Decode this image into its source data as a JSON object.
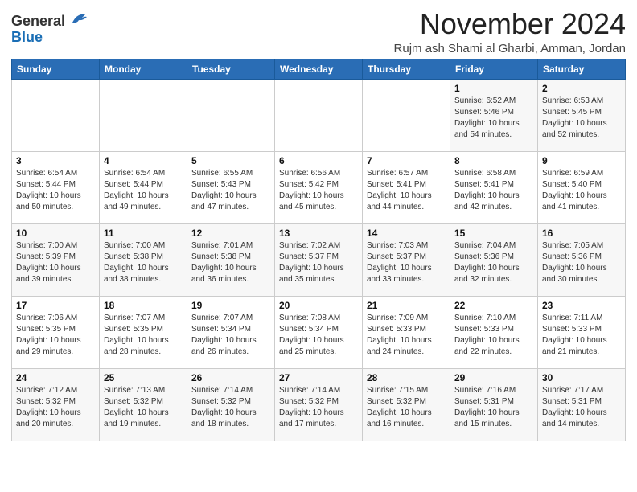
{
  "header": {
    "logo_general": "General",
    "logo_blue": "Blue",
    "month": "November 2024",
    "location": "Rujm ash Shami al Gharbi, Amman, Jordan"
  },
  "days_of_week": [
    "Sunday",
    "Monday",
    "Tuesday",
    "Wednesday",
    "Thursday",
    "Friday",
    "Saturday"
  ],
  "weeks": [
    [
      {
        "day": "",
        "info": ""
      },
      {
        "day": "",
        "info": ""
      },
      {
        "day": "",
        "info": ""
      },
      {
        "day": "",
        "info": ""
      },
      {
        "day": "",
        "info": ""
      },
      {
        "day": "1",
        "info": "Sunrise: 6:52 AM\nSunset: 5:46 PM\nDaylight: 10 hours\nand 54 minutes."
      },
      {
        "day": "2",
        "info": "Sunrise: 6:53 AM\nSunset: 5:45 PM\nDaylight: 10 hours\nand 52 minutes."
      }
    ],
    [
      {
        "day": "3",
        "info": "Sunrise: 6:54 AM\nSunset: 5:44 PM\nDaylight: 10 hours\nand 50 minutes."
      },
      {
        "day": "4",
        "info": "Sunrise: 6:54 AM\nSunset: 5:44 PM\nDaylight: 10 hours\nand 49 minutes."
      },
      {
        "day": "5",
        "info": "Sunrise: 6:55 AM\nSunset: 5:43 PM\nDaylight: 10 hours\nand 47 minutes."
      },
      {
        "day": "6",
        "info": "Sunrise: 6:56 AM\nSunset: 5:42 PM\nDaylight: 10 hours\nand 45 minutes."
      },
      {
        "day": "7",
        "info": "Sunrise: 6:57 AM\nSunset: 5:41 PM\nDaylight: 10 hours\nand 44 minutes."
      },
      {
        "day": "8",
        "info": "Sunrise: 6:58 AM\nSunset: 5:41 PM\nDaylight: 10 hours\nand 42 minutes."
      },
      {
        "day": "9",
        "info": "Sunrise: 6:59 AM\nSunset: 5:40 PM\nDaylight: 10 hours\nand 41 minutes."
      }
    ],
    [
      {
        "day": "10",
        "info": "Sunrise: 7:00 AM\nSunset: 5:39 PM\nDaylight: 10 hours\nand 39 minutes."
      },
      {
        "day": "11",
        "info": "Sunrise: 7:00 AM\nSunset: 5:38 PM\nDaylight: 10 hours\nand 38 minutes."
      },
      {
        "day": "12",
        "info": "Sunrise: 7:01 AM\nSunset: 5:38 PM\nDaylight: 10 hours\nand 36 minutes."
      },
      {
        "day": "13",
        "info": "Sunrise: 7:02 AM\nSunset: 5:37 PM\nDaylight: 10 hours\nand 35 minutes."
      },
      {
        "day": "14",
        "info": "Sunrise: 7:03 AM\nSunset: 5:37 PM\nDaylight: 10 hours\nand 33 minutes."
      },
      {
        "day": "15",
        "info": "Sunrise: 7:04 AM\nSunset: 5:36 PM\nDaylight: 10 hours\nand 32 minutes."
      },
      {
        "day": "16",
        "info": "Sunrise: 7:05 AM\nSunset: 5:36 PM\nDaylight: 10 hours\nand 30 minutes."
      }
    ],
    [
      {
        "day": "17",
        "info": "Sunrise: 7:06 AM\nSunset: 5:35 PM\nDaylight: 10 hours\nand 29 minutes."
      },
      {
        "day": "18",
        "info": "Sunrise: 7:07 AM\nSunset: 5:35 PM\nDaylight: 10 hours\nand 28 minutes."
      },
      {
        "day": "19",
        "info": "Sunrise: 7:07 AM\nSunset: 5:34 PM\nDaylight: 10 hours\nand 26 minutes."
      },
      {
        "day": "20",
        "info": "Sunrise: 7:08 AM\nSunset: 5:34 PM\nDaylight: 10 hours\nand 25 minutes."
      },
      {
        "day": "21",
        "info": "Sunrise: 7:09 AM\nSunset: 5:33 PM\nDaylight: 10 hours\nand 24 minutes."
      },
      {
        "day": "22",
        "info": "Sunrise: 7:10 AM\nSunset: 5:33 PM\nDaylight: 10 hours\nand 22 minutes."
      },
      {
        "day": "23",
        "info": "Sunrise: 7:11 AM\nSunset: 5:33 PM\nDaylight: 10 hours\nand 21 minutes."
      }
    ],
    [
      {
        "day": "24",
        "info": "Sunrise: 7:12 AM\nSunset: 5:32 PM\nDaylight: 10 hours\nand 20 minutes."
      },
      {
        "day": "25",
        "info": "Sunrise: 7:13 AM\nSunset: 5:32 PM\nDaylight: 10 hours\nand 19 minutes."
      },
      {
        "day": "26",
        "info": "Sunrise: 7:14 AM\nSunset: 5:32 PM\nDaylight: 10 hours\nand 18 minutes."
      },
      {
        "day": "27",
        "info": "Sunrise: 7:14 AM\nSunset: 5:32 PM\nDaylight: 10 hours\nand 17 minutes."
      },
      {
        "day": "28",
        "info": "Sunrise: 7:15 AM\nSunset: 5:32 PM\nDaylight: 10 hours\nand 16 minutes."
      },
      {
        "day": "29",
        "info": "Sunrise: 7:16 AM\nSunset: 5:31 PM\nDaylight: 10 hours\nand 15 minutes."
      },
      {
        "day": "30",
        "info": "Sunrise: 7:17 AM\nSunset: 5:31 PM\nDaylight: 10 hours\nand 14 minutes."
      }
    ]
  ]
}
